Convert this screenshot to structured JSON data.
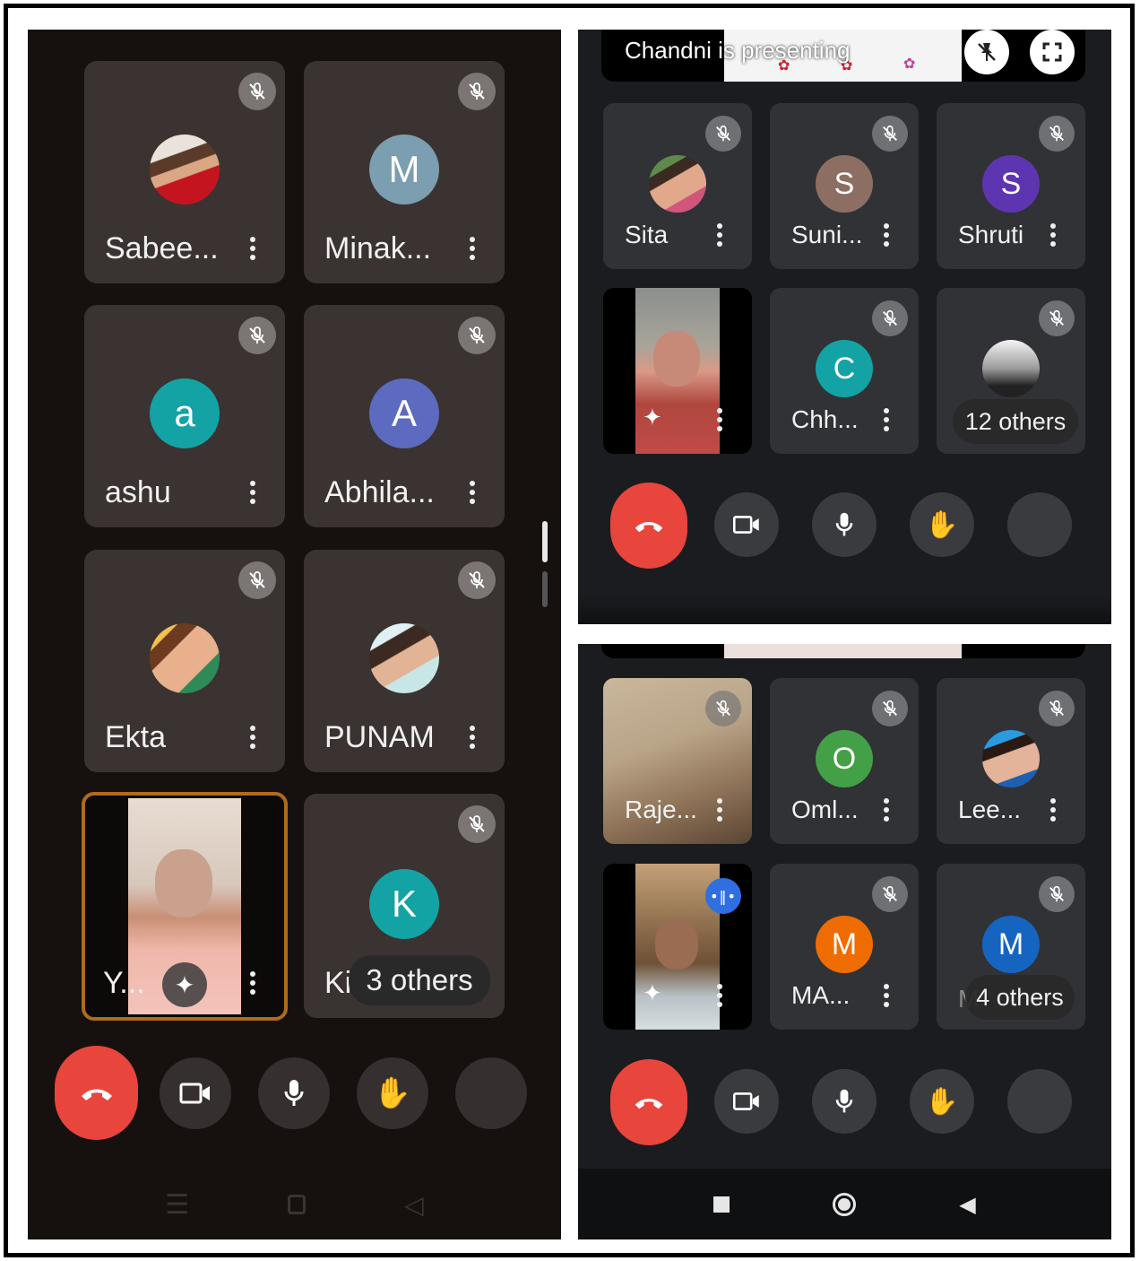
{
  "left_screen": {
    "tiles": [
      {
        "name": "Sabee...",
        "muted": true,
        "avatar": "photo"
      },
      {
        "name": "Minak...",
        "muted": true,
        "avatar_letter": "M",
        "avatar_color": "#7b9eb0"
      },
      {
        "name": "ashu",
        "muted": true,
        "avatar_letter": "a",
        "avatar_color": "#14a3a4"
      },
      {
        "name": "Abhila...",
        "muted": true,
        "avatar_letter": "A",
        "avatar_color": "#5c6bc0"
      },
      {
        "name": "Ekta",
        "muted": true,
        "avatar": "photo"
      },
      {
        "name": "PUNAM",
        "muted": true,
        "avatar": "photo"
      },
      {
        "name": "Y...",
        "video": true,
        "highlighted": true
      },
      {
        "name": "Ki",
        "muted": true,
        "avatar_letter": "K",
        "avatar_color": "#14a3a4",
        "others": "3 others"
      }
    ]
  },
  "right_top": {
    "presenting": "Chandni is presenting",
    "tiles": [
      {
        "name": "Sita",
        "muted": true,
        "avatar": "photo"
      },
      {
        "name": "Suni...",
        "muted": true,
        "avatar_letter": "S",
        "avatar_color": "#8d6e63"
      },
      {
        "name": "Shruti",
        "muted": true,
        "avatar_letter": "S",
        "avatar_color": "#5e35b1"
      },
      {
        "name": "",
        "video": true
      },
      {
        "name": "Chh...",
        "muted": true,
        "avatar_letter": "C",
        "avatar_color": "#14a3a4"
      },
      {
        "name": "",
        "muted": true,
        "avatar": "photo",
        "others": "12 others"
      }
    ]
  },
  "right_bottom": {
    "tiles": [
      {
        "name": "Raje...",
        "muted": true,
        "video": true
      },
      {
        "name": "Oml...",
        "muted": true,
        "avatar_letter": "O",
        "avatar_color": "#43a047"
      },
      {
        "name": "Lee...",
        "muted": true,
        "avatar": "photo"
      },
      {
        "name": "",
        "video": true,
        "speaking": true
      },
      {
        "name": "MA...",
        "muted": true,
        "avatar_letter": "M",
        "avatar_color": "#ef6c00"
      },
      {
        "name": "M",
        "muted": true,
        "avatar_letter": "M",
        "avatar_color": "#1565c0",
        "others": "4 others"
      }
    ]
  },
  "colors": {
    "end_call": "#e8453c",
    "highlight": "#b06a1e"
  }
}
